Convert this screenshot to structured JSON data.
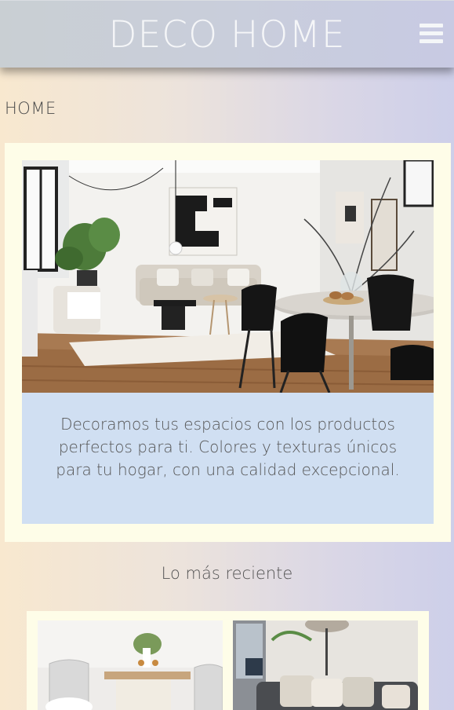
{
  "header": {
    "logo": "DECO HOME",
    "menu_icon": "hamburger-menu-icon"
  },
  "breadcrumb": "HOME",
  "hero": {
    "image_desc": "living-room-photo",
    "text": "Decoramos tus espacios con los productos perfectos para ti. Colores y texturas únicos para tu hogar, con una calidad excepcional."
  },
  "latest": {
    "title": "Lo más reciente",
    "items": [
      {
        "image": "dining-table-photo"
      },
      {
        "image": "sofa-photo"
      }
    ]
  },
  "colors": {
    "hero_card_bg": "#fefde8",
    "text_box_bg": "#d0dff2"
  }
}
